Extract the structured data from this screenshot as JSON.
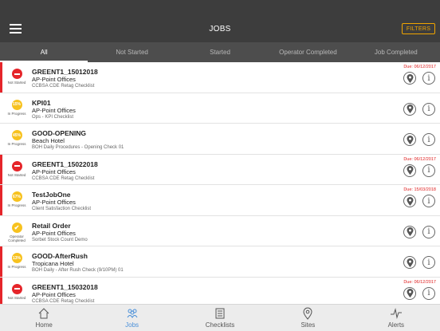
{
  "header": {
    "title": "JOBS",
    "filters_label": "FILTERS"
  },
  "tabs": [
    {
      "label": "All",
      "active": true
    },
    {
      "label": "Not Started",
      "active": false
    },
    {
      "label": "Started",
      "active": false
    },
    {
      "label": "Operator Completed",
      "active": false
    },
    {
      "label": "Job Completed",
      "active": false
    }
  ],
  "status_labels": {
    "not_started": "Not Started",
    "in_progress": "In Progress",
    "operator_completed_1": "Operator",
    "operator_completed_2": "Completed"
  },
  "jobs": [
    {
      "name": "GREENT1_15012018",
      "site": "AP-Point Offices",
      "checklist": "CCBSA CDE Retag Checklist",
      "status": "not_started",
      "due": "Due: 06/12/2017",
      "bar_color": "#e5252a"
    },
    {
      "name": "KPI01",
      "site": "AP-Point Offices",
      "checklist": "Ops - KPI Checklist",
      "status": "in_progress",
      "percent": "15%",
      "due": "",
      "bar_color": "#ffffff"
    },
    {
      "name": "GOOD-OPENING",
      "site": "Beach Hotel",
      "checklist": "BOH Daily Procedures - Opening Check 01",
      "status": "in_progress",
      "percent": "45%",
      "due": "",
      "bar_color": "#ffffff"
    },
    {
      "name": "GREENT1_15022018",
      "site": "AP-Point Offices",
      "checklist": "CCBSA CDE Retag Checklist",
      "status": "not_started",
      "due": "Due: 06/12/2017",
      "bar_color": "#e5252a"
    },
    {
      "name": "TestJobOne",
      "site": "AP-Point Offices",
      "checklist": "Client Satisfaction Checklist",
      "status": "in_progress",
      "percent": "67%",
      "due": "Due: 15/03/2018",
      "bar_color": "#e5252a"
    },
    {
      "name": "Retail Order",
      "site": "AP-Point Offices",
      "checklist": "Sorbet Stock Count Demo",
      "status": "operator_completed",
      "due": "",
      "bar_color": "#ffffff"
    },
    {
      "name": "GOOD-AfterRush",
      "site": "Tropicana Hotel",
      "checklist": "BOH Daily - After Rush Check (9/10PM) 01",
      "status": "in_progress",
      "percent": "13%",
      "due": "",
      "bar_color": "#e5252a"
    },
    {
      "name": "GREENT1_15032018",
      "site": "AP-Point Offices",
      "checklist": "CCBSA CDE Retag Checklist",
      "status": "not_started",
      "due": "Due: 06/12/2017",
      "bar_color": "#e5252a"
    }
  ],
  "bottom_nav": [
    {
      "label": "Home",
      "icon": "home-icon",
      "active": false
    },
    {
      "label": "Jobs",
      "icon": "people-icon",
      "active": true
    },
    {
      "label": "Checklists",
      "icon": "checklist-icon",
      "active": false
    },
    {
      "label": "Sites",
      "icon": "location-pin-icon",
      "active": false
    },
    {
      "label": "Alerts",
      "icon": "pulse-icon",
      "active": false
    }
  ],
  "colors": {
    "header": "#3d3d3d",
    "tabs": "#4d4d4d",
    "accent": "#f0a500",
    "due": "#e02020",
    "nav_active": "#4a90d9"
  }
}
